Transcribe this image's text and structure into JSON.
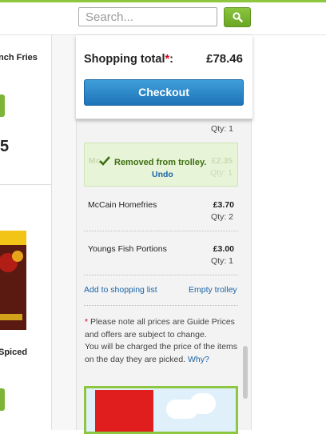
{
  "header": {
    "search_placeholder": "Search...",
    "brand_color": "#8dc63f"
  },
  "left_products": [
    {
      "name_fragment": "nch Fries"
    },
    {
      "price_fragment": "5"
    },
    {
      "name_fragment": "Spiced"
    }
  ],
  "trolley": {
    "total_label": "Shopping total",
    "total_star": "*",
    "total_suffix": ":",
    "total_value": "£78.46",
    "checkout_label": "Checkout",
    "prev_item_qty": "Qty: 1",
    "removed": {
      "message": "Removed from trolley.",
      "undo_label": "Undo",
      "ghost_name": "Mc",
      "ghost_price": "£2.35",
      "ghost_qty": "Qty: 1"
    },
    "items": [
      {
        "name": "McCain Homefries",
        "price": "£3.70",
        "qty": "Qty: 2"
      },
      {
        "name": "Youngs Fish Portions",
        "price": "£3.00",
        "qty": "Qty: 1"
      }
    ],
    "add_to_list_label": "Add to shopping list",
    "empty_trolley_label": "Empty trolley",
    "note": {
      "star": "*",
      "text": " Please note all prices are Guide Prices and offers are subject to change.",
      "text2": "You will be charged the price of the items on the day they are picked.",
      "why_label": "Why?"
    }
  },
  "icons": {
    "search": "search-icon",
    "check": "check-icon"
  }
}
